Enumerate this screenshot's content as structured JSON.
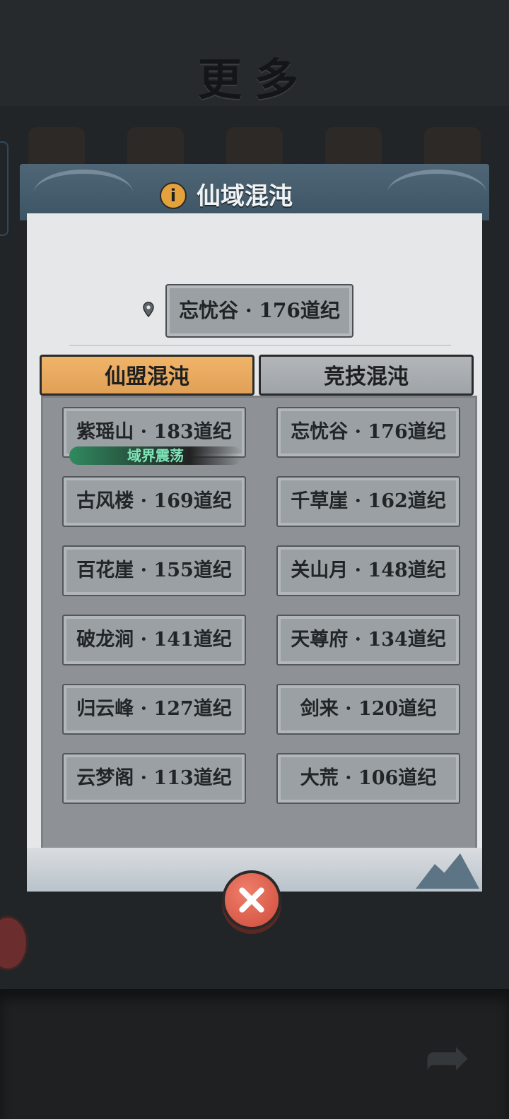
{
  "background": {
    "page_title": "更多"
  },
  "dialog": {
    "title": "仙域混沌",
    "current_location": "忘忧谷 · 176道纪",
    "tabs": [
      {
        "label": "仙盟混沌",
        "active": true
      },
      {
        "label": "竞技混沌",
        "active": false
      }
    ],
    "items": [
      {
        "label": "紫瑶山 · 183道纪",
        "badge": "域界震荡"
      },
      {
        "label": "忘忧谷 · 176道纪"
      },
      {
        "label": "古风楼 · 169道纪"
      },
      {
        "label": "千草崖 · 162道纪"
      },
      {
        "label": "百花崖 · 155道纪"
      },
      {
        "label": "关山月 · 148道纪"
      },
      {
        "label": "破龙涧 · 141道纪"
      },
      {
        "label": "天尊府 · 134道纪"
      },
      {
        "label": "归云峰 · 127道纪"
      },
      {
        "label": "剑来 · 120道纪"
      },
      {
        "label": "云梦阁 · 113道纪"
      },
      {
        "label": "大荒 · 106道纪"
      }
    ]
  },
  "colors": {
    "active_tab": "#e8a85e",
    "inactive_tab": "#a8adb1",
    "header": "#475e6e",
    "close_button": "#d9584a",
    "badge_text": "#7fe5b9"
  },
  "icons": {
    "info": "info-icon",
    "location": "map-pin-icon",
    "close": "close-icon"
  }
}
